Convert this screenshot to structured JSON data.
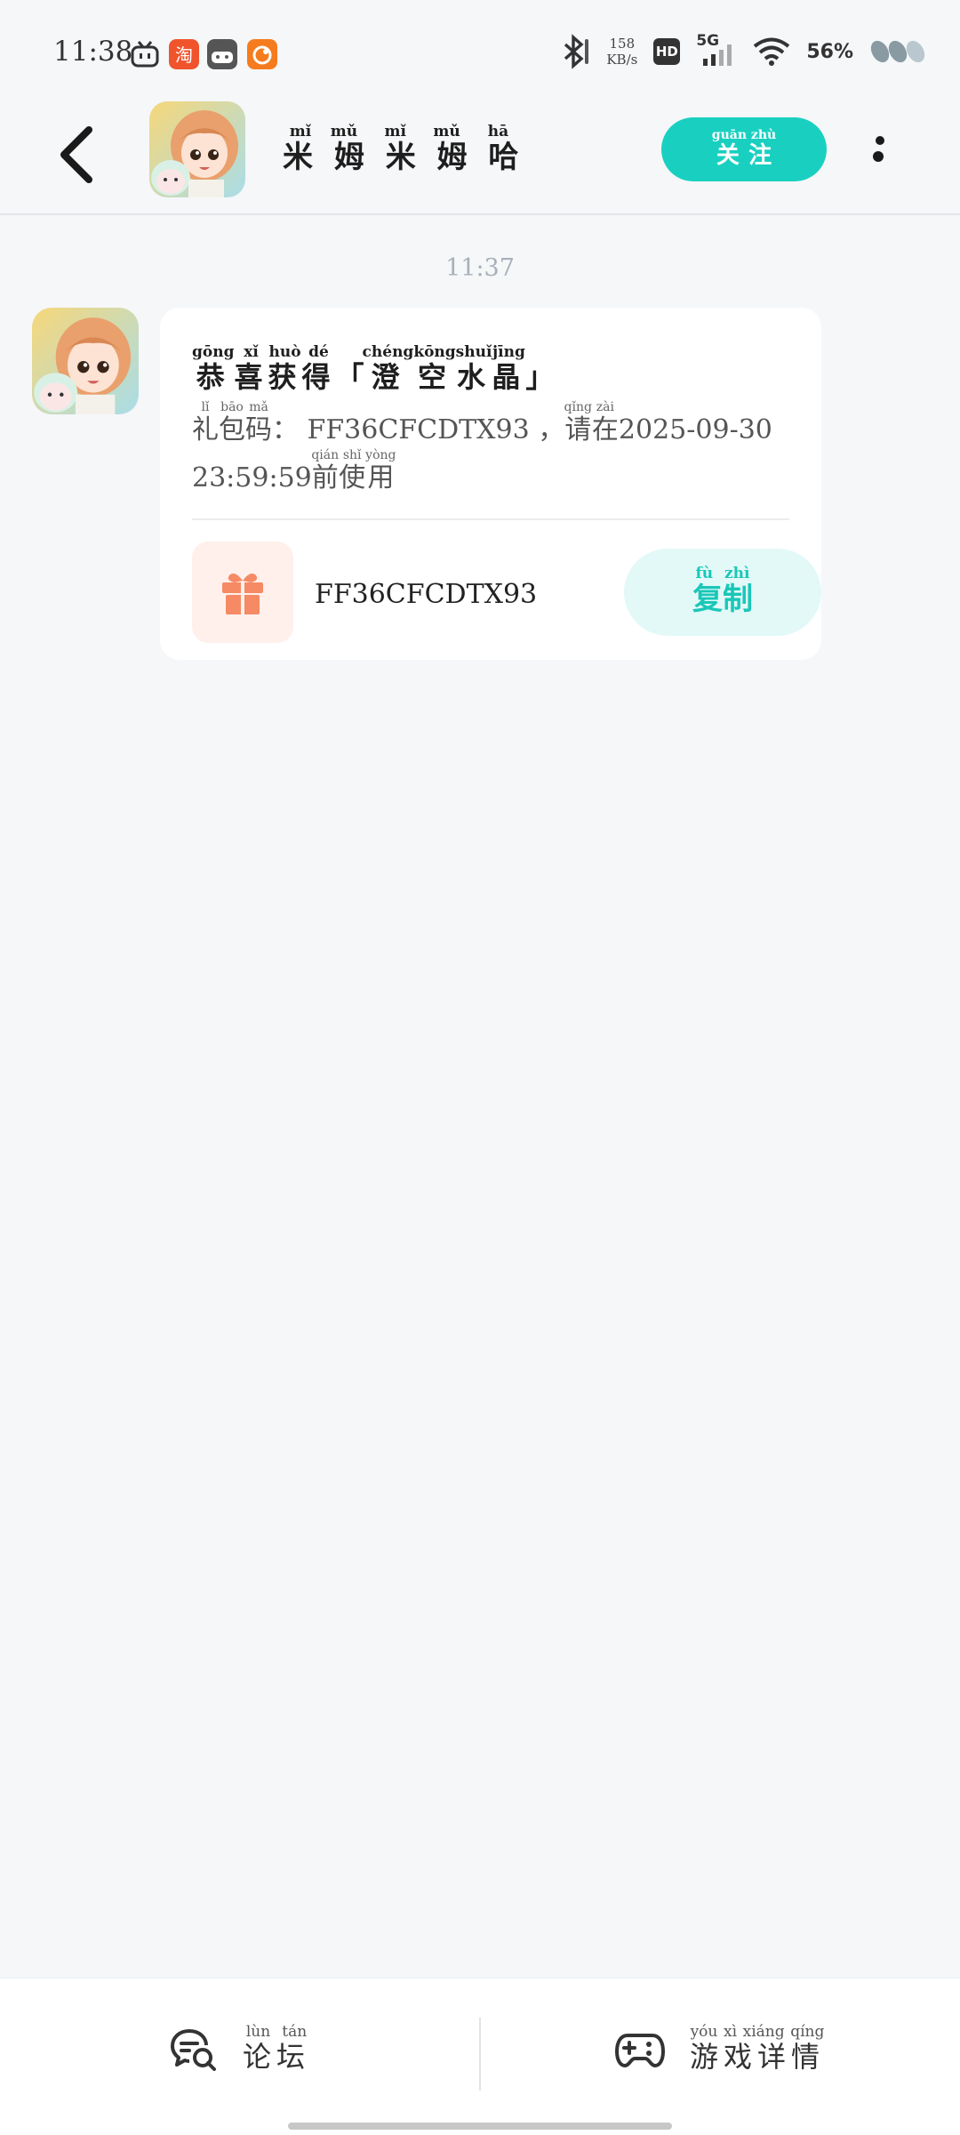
{
  "status_bar": {
    "time": "11:38",
    "net_speed_value": "158",
    "net_speed_unit": "KB/s",
    "hd_label": "HD",
    "network_type": "5G",
    "battery": "56%",
    "icons": [
      "tv-app-icon",
      "taobao-app-icon",
      "game-app-icon",
      "orange-app-icon",
      "bluetooth-icon",
      "signal-icon",
      "wifi-icon",
      "battery-icon"
    ]
  },
  "header": {
    "title_chars": [
      "米",
      "姆",
      "米",
      "姆",
      "哈"
    ],
    "title_pinyin": [
      "mǐ",
      "mǔ",
      "mǐ",
      "mǔ",
      "hā"
    ],
    "follow_label": "关注",
    "follow_pinyin": "guān zhù"
  },
  "message": {
    "time": "11:37",
    "title_parts": [
      {
        "t": "恭",
        "p": "gōng"
      },
      {
        "t": "喜",
        "p": "xǐ"
      },
      {
        "t": "获",
        "p": "huò"
      },
      {
        "t": "得",
        "p": "dé"
      },
      {
        "t": "「",
        "p": ""
      },
      {
        "t": "澄",
        "p": "chéng"
      },
      {
        "t": "空",
        "p": "kōng"
      },
      {
        "t": "水",
        "p": "shuǐ"
      },
      {
        "t": "晶",
        "p": "jīng"
      },
      {
        "t": "」",
        "p": ""
      }
    ],
    "desc_parts": [
      {
        "t": "礼",
        "p": "lǐ"
      },
      {
        "t": "包",
        "p": "bāo"
      },
      {
        "t": "码",
        "p": "mǎ"
      },
      {
        "t": "： FF36CFCDTX93 ，",
        "p": ""
      },
      {
        "t": "请",
        "p": "qǐng"
      },
      {
        "t": "在",
        "p": "zài"
      },
      {
        "t": "2025-09-30 23:59:59",
        "p": ""
      },
      {
        "t": "前",
        "p": "qián"
      },
      {
        "t": "使",
        "p": "shǐ"
      },
      {
        "t": "用",
        "p": "yòng"
      }
    ],
    "gift_code": "FF36CFCDTX93",
    "copy_label": "复制",
    "copy_pinyin": "fù zhì"
  },
  "bottom_bar": {
    "forum_label": "论坛",
    "forum_pinyin": "lùn tán",
    "game_label": "游戏详情",
    "game_pinyin": "yóu xì xiáng qíng"
  },
  "colors": {
    "accent": "#19d0c0",
    "background": "#f5f7f9",
    "gift": "#f58a64"
  }
}
